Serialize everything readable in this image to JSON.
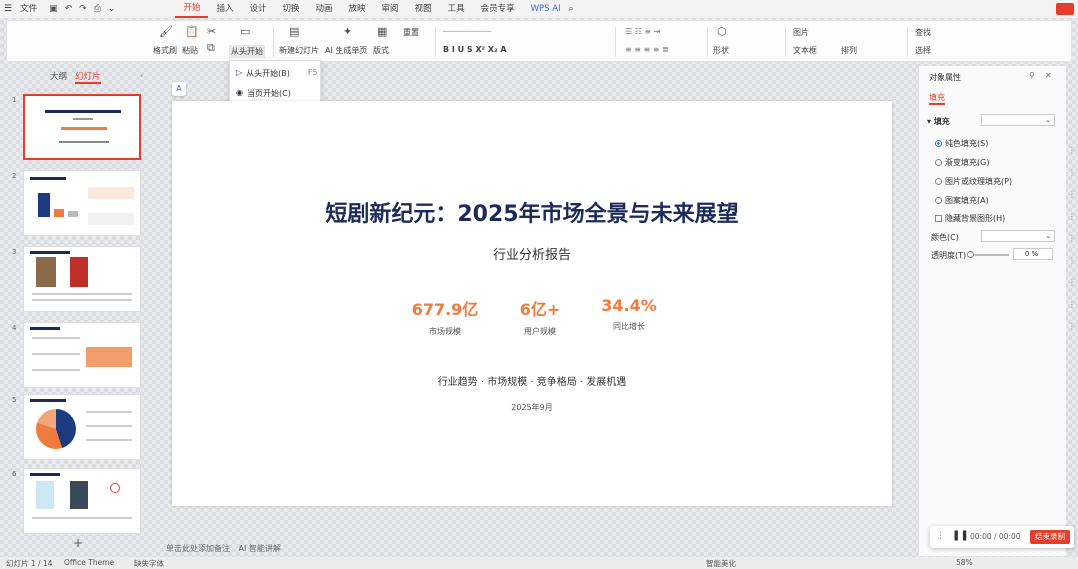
{
  "menubar": {
    "file_label": "文件",
    "tabs": [
      "开始",
      "插入",
      "设计",
      "切换",
      "动画",
      "放映",
      "审阅",
      "视图",
      "工具",
      "会员专享",
      "WPS AI"
    ],
    "active_tab": "开始"
  },
  "ribbon": {
    "format_painter": "格式刷",
    "paste": "粘贴",
    "from_start": "从头开始",
    "new_slide": "新建幻灯片",
    "ai_generate": "AI 生成单页",
    "layout": "版式",
    "reset": "重置",
    "shape_label": "形状",
    "textbox": "文本框",
    "arrange": "排列",
    "find": "查找",
    "select": "选择",
    "picture": "图片"
  },
  "dropdown": {
    "items": [
      {
        "label": "从头开始(B)",
        "shortcut": "F5"
      },
      {
        "label": "当页开始(C)",
        "shortcut": ""
      }
    ]
  },
  "left_panel": {
    "tabs": [
      "大纲",
      "幻灯片"
    ],
    "active": "幻灯片",
    "numbers": [
      "1",
      "2",
      "3",
      "4",
      "5",
      "6"
    ]
  },
  "slide": {
    "title": "短剧新纪元：2025年市场全景与未来展望",
    "subtitle": "行业分析报告",
    "stats": [
      {
        "value": "677.9亿",
        "label": "市场规模"
      },
      {
        "value": "6亿+",
        "label": "用户规模"
      },
      {
        "value": "34.4%",
        "label": "同比增长"
      }
    ],
    "tags": "行业趋势 · 市场规模 · 竞争格局 · 发展机遇",
    "date": "2025年9月"
  },
  "right_panel": {
    "title": "对象属性",
    "tab": "填充",
    "fill_section": "填充",
    "options": [
      {
        "label": "纯色填充(S)",
        "checked": true
      },
      {
        "label": "渐变填充(G)",
        "checked": false
      },
      {
        "label": "图片或纹理填充(P)",
        "checked": false
      },
      {
        "label": "图案填充(A)",
        "checked": false
      }
    ],
    "hide_bg": "隐藏背景图形(H)",
    "color_label": "颜色(C)",
    "transparency_label": "透明度(T)",
    "transparency_value": "0",
    "transparency_unit": "%"
  },
  "bottom": {
    "notes_hint": "单击此处添加备注",
    "ai_note": "AI 智能讲解",
    "slide_count": "幻灯片 1 / 14",
    "theme": "Office Theme",
    "missing_font": "缺失字体",
    "smart_beautify": "智能美化",
    "zoom": "58%"
  },
  "recorder": {
    "time": "00:00 / 00:00",
    "stop_label": "结束录制"
  }
}
